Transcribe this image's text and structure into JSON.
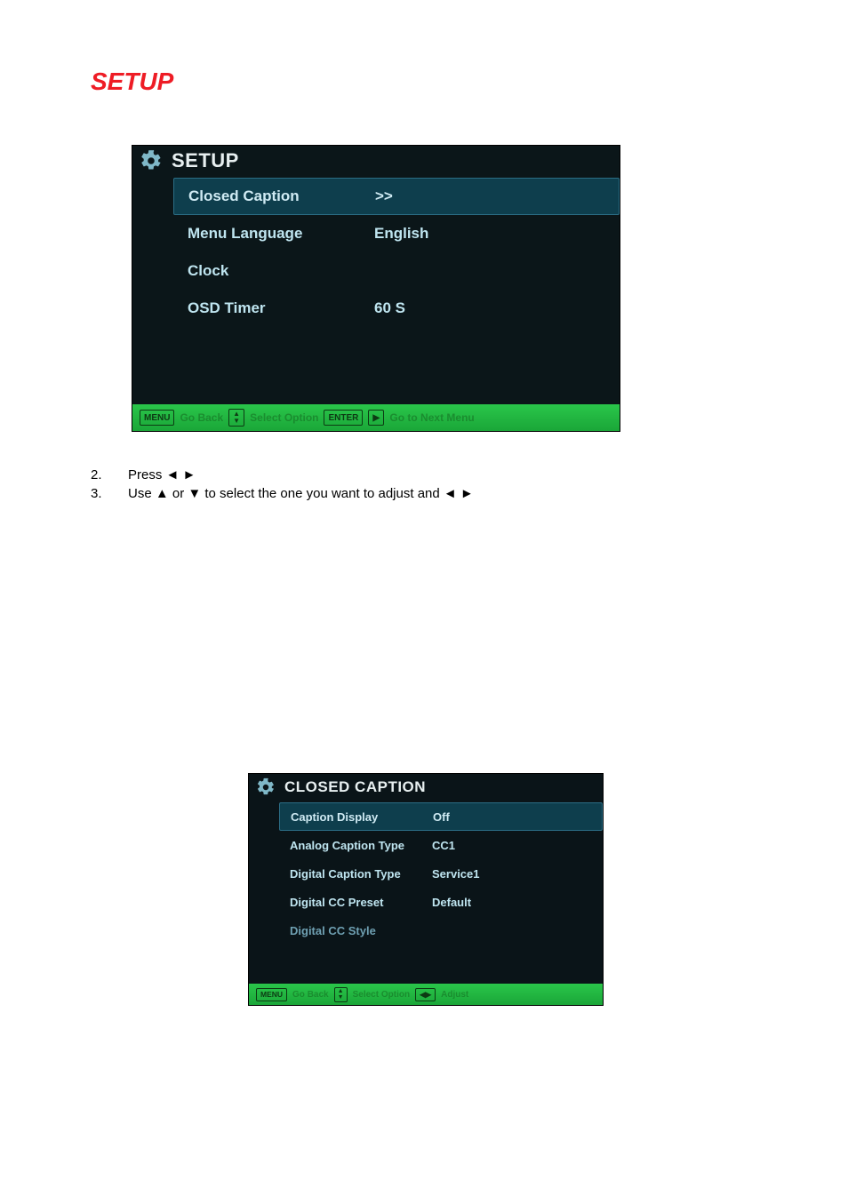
{
  "heading": "SETUP",
  "setup_menu": {
    "title": "SETUP",
    "rows": [
      {
        "label": "Closed Caption",
        "value": ">>",
        "selected": true
      },
      {
        "label": "Menu Language",
        "value": "English"
      },
      {
        "label": "Clock",
        "value": ""
      },
      {
        "label": "OSD Timer",
        "value": "60 S"
      }
    ],
    "footer": {
      "menu": "MENU",
      "go_back": "Go Back",
      "select_option": "Select Option",
      "enter": "ENTER",
      "go_next": "Go to Next Menu",
      "play_icon": "▶"
    }
  },
  "instructions": [
    {
      "num": "2.",
      "text": "Press ◄    ►"
    },
    {
      "num": "3.",
      "text": "Use ▲ or ▼ to select the one you want to adjust and ◄    ►"
    }
  ],
  "cc_menu": {
    "title": "CLOSED CAPTION",
    "rows": [
      {
        "label": "Caption Display",
        "value": "Off",
        "selected": true
      },
      {
        "label": "Analog Caption Type",
        "value": "CC1"
      },
      {
        "label": "Digital Caption Type",
        "value": "Service1"
      },
      {
        "label": "Digital CC Preset",
        "value": "Default"
      },
      {
        "label": "Digital CC Style",
        "value": "",
        "dim": true
      }
    ],
    "footer": {
      "menu": "MENU",
      "go_back": "Go Back",
      "select_option": "Select Option",
      "adjust": "Adjust",
      "lr_icon": "◀▶"
    }
  }
}
